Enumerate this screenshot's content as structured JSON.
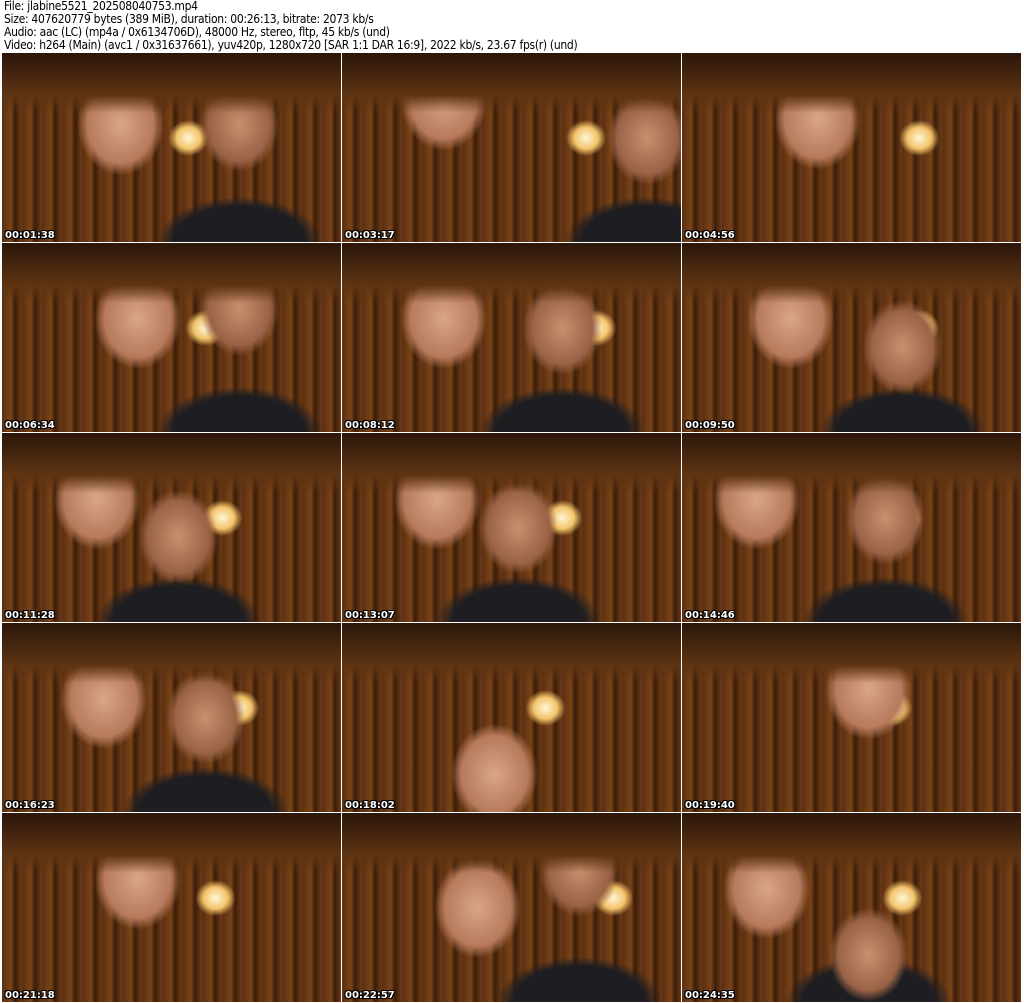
{
  "header": {
    "file_line": "File: jlabine5521_202508040753.mp4",
    "size_line": "Size: 407620779 bytes (389 MiB), duration: 00:26:13, bitrate: 2073 kb/s",
    "audio_line": "Audio: aac (LC) (mp4a / 0x6134706D), 48000 Hz, stereo, fltp, 45 kb/s (und)",
    "video_line": "Video: h264 (Main) (avc1 / 0x31637661), yuv420p, 1280x720 [SAR 1:1 DAR 16:9], 2022 kb/s, 23.67 fps(r) (und)"
  },
  "thumbnails": [
    {
      "timestamp": "00:01:38"
    },
    {
      "timestamp": "00:03:17"
    },
    {
      "timestamp": "00:04:56"
    },
    {
      "timestamp": "00:06:34"
    },
    {
      "timestamp": "00:08:12"
    },
    {
      "timestamp": "00:09:50"
    },
    {
      "timestamp": "00:11:28"
    },
    {
      "timestamp": "00:13:07"
    },
    {
      "timestamp": "00:14:46"
    },
    {
      "timestamp": "00:16:23"
    },
    {
      "timestamp": "00:18:02"
    },
    {
      "timestamp": "00:19:40"
    },
    {
      "timestamp": "00:21:18"
    },
    {
      "timestamp": "00:22:57"
    },
    {
      "timestamp": "00:24:35"
    }
  ]
}
